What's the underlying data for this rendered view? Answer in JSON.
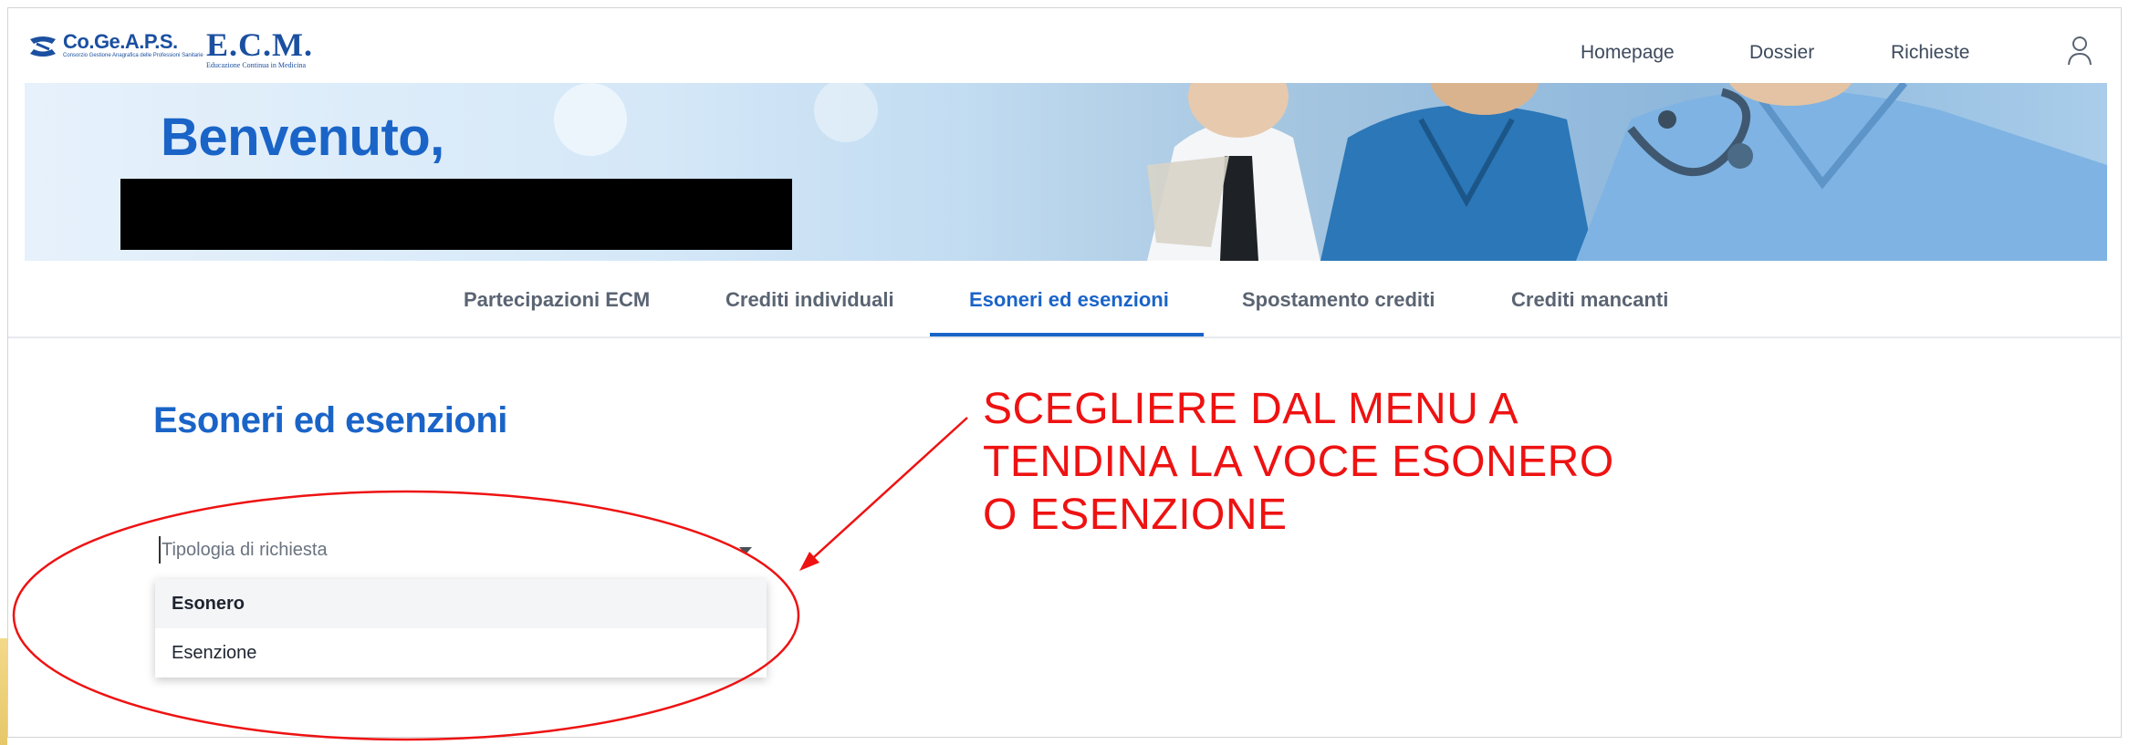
{
  "logos": {
    "cogeaps_name": "Co.Ge.A.P.S.",
    "cogeaps_tagline": "Consorzio Gestione Anagrafica delle Professioni Sanitarie",
    "ecm_name": "E.C.M.",
    "ecm_tagline": "Educazione Continua in Medicina"
  },
  "topnav": {
    "homepage": "Homepage",
    "dossier": "Dossier",
    "requests": "Richieste",
    "user_icon": "user-icon"
  },
  "hero": {
    "greeting": "Benvenuto,"
  },
  "tabs": [
    {
      "label": "Partecipazioni ECM",
      "active": false
    },
    {
      "label": "Crediti individuali",
      "active": false
    },
    {
      "label": "Esoneri ed esenzioni",
      "active": true
    },
    {
      "label": "Spostamento crediti",
      "active": false
    },
    {
      "label": "Crediti mancanti",
      "active": false
    }
  ],
  "content": {
    "title": "Esoneri ed esenzioni",
    "select": {
      "placeholder": "Tipologia di richiesta",
      "options": [
        "Esonero",
        "Esenzione"
      ],
      "highlighted": "Esonero"
    }
  },
  "annotation": {
    "lines": [
      "SCEGLIERE DAL MENU A",
      "TENDINA LA VOCE ESONERO",
      "O ESENZIONE"
    ],
    "color": "#ee1212"
  },
  "colors": {
    "brand_blue": "#1a64c8",
    "logo_blue": "#1b4fa0"
  }
}
